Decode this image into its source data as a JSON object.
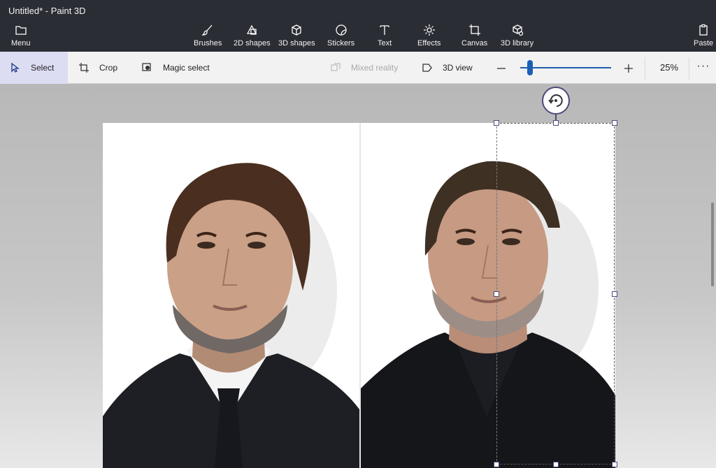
{
  "window": {
    "title": "Untitled* - Paint 3D"
  },
  "menu": {
    "label": "Menu",
    "icon": "folder-icon"
  },
  "toolbar_top": {
    "items": [
      {
        "label": "Brushes",
        "icon": "brush-icon"
      },
      {
        "label": "2D shapes",
        "icon": "shapes-2d-icon"
      },
      {
        "label": "3D shapes",
        "icon": "cube-icon"
      },
      {
        "label": "Stickers",
        "icon": "sticker-icon"
      },
      {
        "label": "Text",
        "icon": "text-icon"
      },
      {
        "label": "Effects",
        "icon": "sun-icon"
      },
      {
        "label": "Canvas",
        "icon": "canvas-icon"
      },
      {
        "label": "3D library",
        "icon": "library-icon"
      }
    ],
    "paste": {
      "label": "Paste",
      "icon": "clipboard-icon"
    }
  },
  "subtoolbar": {
    "select": "Select",
    "crop": "Crop",
    "magic_select": "Magic select",
    "mixed_reality": "Mixed reality",
    "view_3d": "3D view",
    "zoom_value": "25%",
    "zoom_level": 0.1,
    "more": "···"
  },
  "colors": {
    "titlebar_bg": "#2b2d35",
    "toolbar_bg": "#f2f2f2",
    "select_active": "#dcdcf3",
    "accent": "#1a5fb4"
  }
}
